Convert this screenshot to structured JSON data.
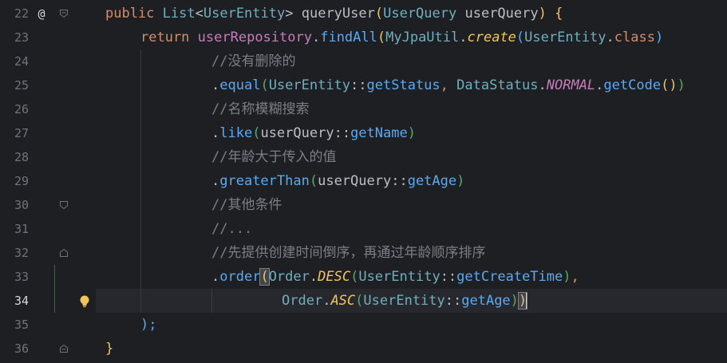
{
  "gutter": {
    "line_numbers": [
      "22",
      "23",
      "24",
      "25",
      "26",
      "27",
      "28",
      "29",
      "30",
      "31",
      "32",
      "33",
      "34",
      "35",
      "36"
    ],
    "current_line": "34",
    "annotation_symbol": "@"
  },
  "code": {
    "l22": {
      "kw_public": "public",
      "type_list": "List",
      "lt": "<",
      "type_entity": "UserEntity",
      "gt": ">",
      "name": "queryUser",
      "lp": "(",
      "param_type": "UserQuery",
      "param_name": "userQuery",
      "rp": ")",
      "brace": "{"
    },
    "l23": {
      "kw_return": "return",
      "repo": "userRepository",
      "dot1": ".",
      "find": "findAll",
      "lp": "(",
      "util": "MyJpaUtil",
      "dot2": ".",
      "create": "create",
      "lp2": "(",
      "cls": "UserEntity",
      "dot3": ".",
      "kwclass": "class",
      "rp": ")"
    },
    "l24": {
      "comment_prefix": "//",
      "comment": "没有删除的"
    },
    "l25": {
      "dot": ".",
      "method": "equal",
      "lp": "(",
      "cls": "UserEntity",
      "sep": "::",
      "getter": "getStatus",
      "comma": ", ",
      "ds": "DataStatus",
      "dot2": ".",
      "normal": "NORMAL",
      "dot3": ".",
      "getcode": "getCode",
      "paren": "()",
      "rp": ")"
    },
    "l26": {
      "comment_prefix": "//",
      "comment": "名称模糊搜索"
    },
    "l27": {
      "dot": ".",
      "method": "like",
      "lp": "(",
      "obj": "userQuery",
      "sep": "::",
      "getter": "getName",
      "rp": ")"
    },
    "l28": {
      "comment_prefix": "//",
      "comment": "年龄大于传入的值"
    },
    "l29": {
      "dot": ".",
      "method": "greaterThan",
      "lp": "(",
      "obj": "userQuery",
      "sep": "::",
      "getter": "getAge",
      "rp": ")"
    },
    "l30": {
      "comment_prefix": "//",
      "comment": "其他条件"
    },
    "l31": {
      "comment": "//..."
    },
    "l32": {
      "comment_prefix": "//",
      "comment": "先提供创建时间倒序，再通过年龄顺序排序"
    },
    "l33": {
      "dot": ".",
      "method": "order",
      "lp": "(",
      "order": "Order",
      "dot2": ".",
      "desc": "DESC",
      "lp2": "(",
      "cls": "UserEntity",
      "sep": "::",
      "getter": "getCreateTime",
      "rp": ")",
      "comma": ","
    },
    "l34": {
      "order": "Order",
      "dot": ".",
      "asc": "ASC",
      "lp": "(",
      "cls": "UserEntity",
      "sep": "::",
      "getter": "getAge",
      "rp": ")",
      "rp2": ")"
    },
    "l35": {
      "close": ");"
    },
    "l36": {
      "close": "}"
    }
  }
}
